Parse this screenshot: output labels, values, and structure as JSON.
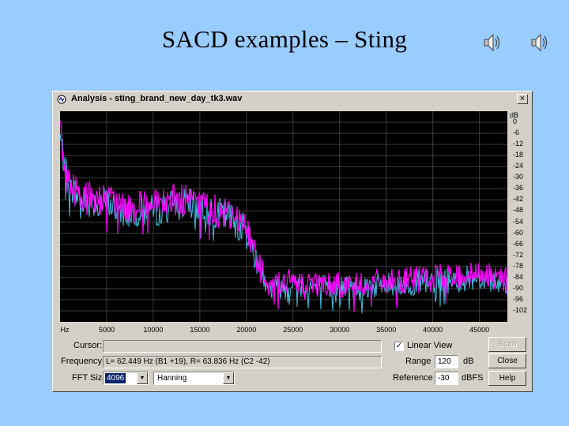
{
  "slide": {
    "title": "SACD examples – Sting"
  },
  "window": {
    "title": "Analysis - sting_brand_new_day_tk3.wav",
    "close_glyph": "×"
  },
  "chart_data": {
    "type": "line",
    "y_unit_label": "dB",
    "x_ticks": [
      "Hz",
      "5000",
      "10000",
      "15000",
      "20000",
      "25000",
      "30000",
      "35000",
      "40000",
      "45000"
    ],
    "x_tick_values": [
      0,
      5000,
      10000,
      15000,
      20000,
      25000,
      30000,
      35000,
      40000,
      45000
    ],
    "xlim": [
      0,
      48000
    ],
    "y_ticks": [
      "0",
      "-6",
      "-12",
      "-18",
      "-24",
      "-30",
      "-36",
      "-42",
      "-48",
      "-54",
      "-60",
      "-66",
      "-72",
      "-78",
      "-84",
      "-90",
      "-96",
      "-102"
    ],
    "y_tick_values": [
      0,
      -6,
      -12,
      -18,
      -24,
      -30,
      -36,
      -42,
      -48,
      -54,
      -60,
      -66,
      -72,
      -78,
      -84,
      -90,
      -96,
      -102
    ],
    "ylim": [
      6,
      -108
    ],
    "grid": true,
    "series": [
      {
        "color": "#40c0e0",
        "x": [
          0,
          400,
          1000,
          2000,
          3000,
          5000,
          7500,
          10000,
          12500,
          15000,
          17500,
          19000,
          20000,
          21000,
          22500,
          25000,
          30000,
          35000,
          40000,
          45000,
          48000
        ],
        "y": [
          -8,
          -20,
          -36,
          -40,
          -42,
          -44,
          -48,
          -48,
          -44,
          -46,
          -50,
          -54,
          -60,
          -72,
          -90,
          -88,
          -90,
          -88,
          -86,
          -84,
          -86
        ]
      },
      {
        "color": "#ff00ff",
        "x": [
          0,
          400,
          1000,
          2000,
          3000,
          5000,
          7500,
          10000,
          12500,
          15000,
          17500,
          19000,
          20000,
          21000,
          22500,
          25000,
          30000,
          35000,
          40000,
          45000,
          48000
        ],
        "y": [
          -6,
          -22,
          -34,
          -38,
          -40,
          -42,
          -46,
          -46,
          -42,
          -44,
          -48,
          -52,
          -58,
          -72,
          -88,
          -86,
          -88,
          -86,
          -84,
          -82,
          -85
        ]
      }
    ]
  },
  "controls": {
    "cursor_label": "Cursor:",
    "cursor_value": "",
    "frequency_label": "Frequency:",
    "frequency_value": "L= 62.449 Hz (B1 +19), R= 63.836 Hz (C2 -42)",
    "fft_label": "FFT Size:",
    "fft_value": "4096",
    "window_fn_value": "Hanning",
    "linear_view_label": "Linear View",
    "linear_view_checked": true,
    "check_glyph": "✓",
    "range_label": "Range",
    "range_value": "120",
    "range_unit": "dB",
    "reference_label": "Reference",
    "reference_value": "-30",
    "reference_unit": "dBFS",
    "scan_button": "Scan",
    "close_button": "Close",
    "help_button": "Help",
    "dropdown_arrow": "▼"
  }
}
